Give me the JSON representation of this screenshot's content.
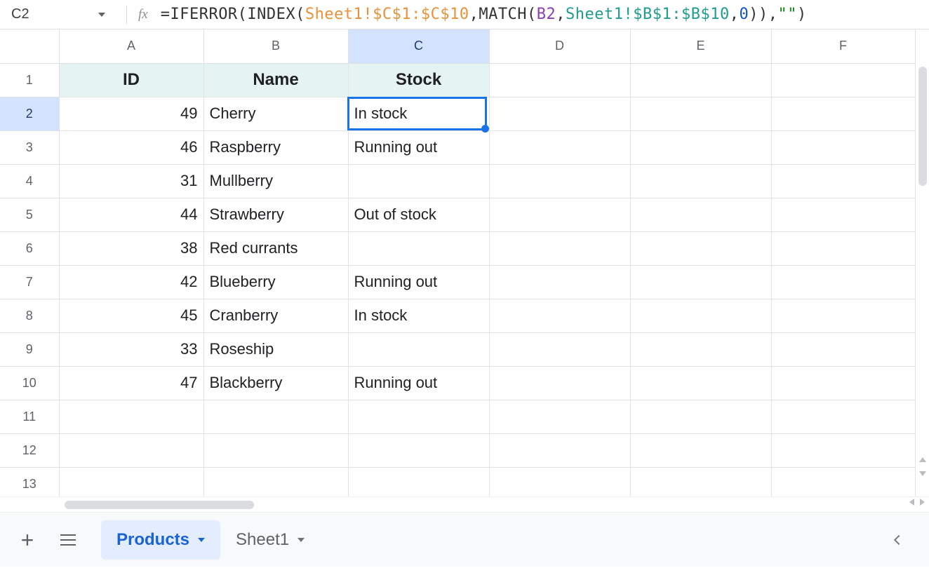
{
  "nameBox": "C2",
  "fxLabel": "fx",
  "formula": {
    "p1": "=IFERROR(INDEX(",
    "r1": "Sheet1!$C$1:$C$10",
    "p2": ",MATCH(",
    "r2": "B2",
    "p3": ",",
    "r3": "Sheet1!$B$1:$B$10",
    "p4": ",",
    "n0": "0",
    "p5": ")),",
    "s1": "\"\"",
    "p6": ")"
  },
  "columns": [
    "A",
    "B",
    "C",
    "D",
    "E",
    "F"
  ],
  "rowNumbers": [
    "1",
    "2",
    "3",
    "4",
    "5",
    "6",
    "7",
    "8",
    "9",
    "10",
    "11",
    "12",
    "13"
  ],
  "headers": {
    "id": "ID",
    "name": "Name",
    "stock": "Stock"
  },
  "rows": [
    {
      "id": "49",
      "name": "Cherry",
      "stock": "In stock"
    },
    {
      "id": "46",
      "name": "Raspberry",
      "stock": "Running out"
    },
    {
      "id": "31",
      "name": "Mullberry",
      "stock": ""
    },
    {
      "id": "44",
      "name": "Strawberry",
      "stock": "Out of stock"
    },
    {
      "id": "38",
      "name": "Red currants",
      "stock": ""
    },
    {
      "id": "42",
      "name": "Blueberry",
      "stock": "Running out"
    },
    {
      "id": "45",
      "name": "Cranberry",
      "stock": "In stock"
    },
    {
      "id": "33",
      "name": "Roseship",
      "stock": ""
    },
    {
      "id": "47",
      "name": "Blackberry",
      "stock": "Running out"
    }
  ],
  "tabs": {
    "active": "Products",
    "other": "Sheet1"
  },
  "selectedColumn": "C",
  "selectedRow": "2"
}
